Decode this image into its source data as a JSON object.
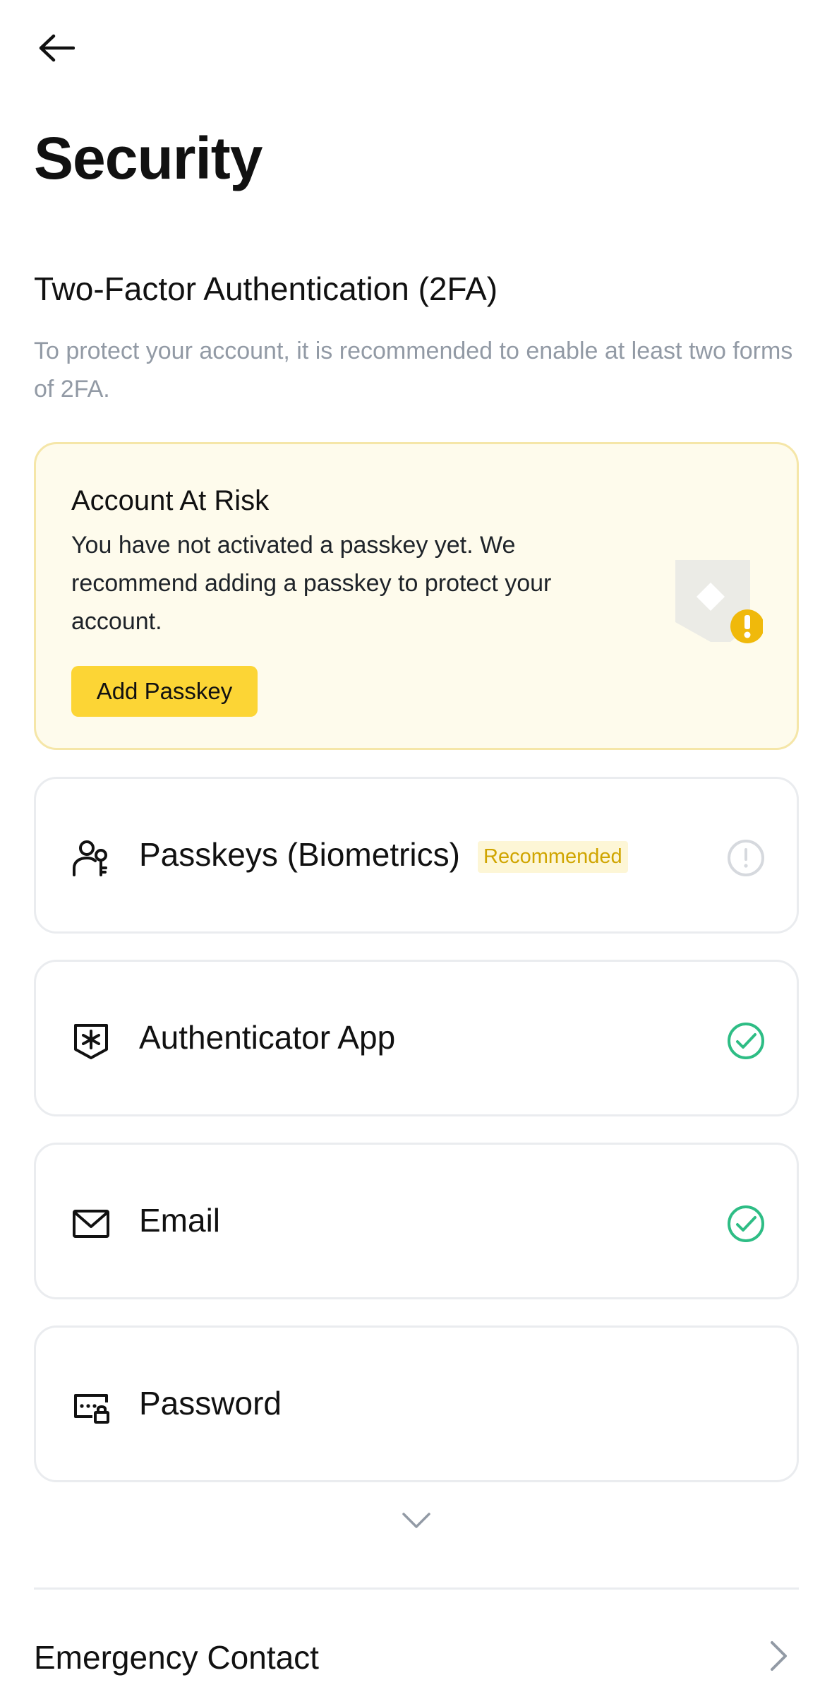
{
  "header": {
    "back_icon": "arrow-left-icon",
    "title": "Security"
  },
  "two_factor": {
    "title": "Two-Factor Authentication (2FA)",
    "description": "To protect your account, it is recommended to enable at least two forms of 2FA."
  },
  "risk_card": {
    "title": "Account At Risk",
    "text": "You have not activated a passkey yet. We recommend adding a passkey to protect your account.",
    "button_label": "Add Passkey",
    "illustration_icon": "shield-warning-icon"
  },
  "methods": [
    {
      "label": "Passkeys (Biometrics)",
      "badge": "Recommended",
      "icon": "person-key-icon",
      "status": "warning"
    },
    {
      "label": "Authenticator App",
      "icon": "shield-asterisk-icon",
      "status": "enabled"
    },
    {
      "label": "Email",
      "icon": "envelope-icon",
      "status": "enabled"
    },
    {
      "label": "Password",
      "icon": "password-lock-icon",
      "status": "none"
    }
  ],
  "expand_icon": "chevron-down-icon",
  "emergency": {
    "label": "Emergency Contact",
    "icon": "chevron-right-icon"
  },
  "colors": {
    "accent": "#FCD535",
    "risk_bg": "#FEFBEC",
    "success": "#2EBD85",
    "warning_badge_text": "#D0A500",
    "muted_text": "#929AA5"
  }
}
